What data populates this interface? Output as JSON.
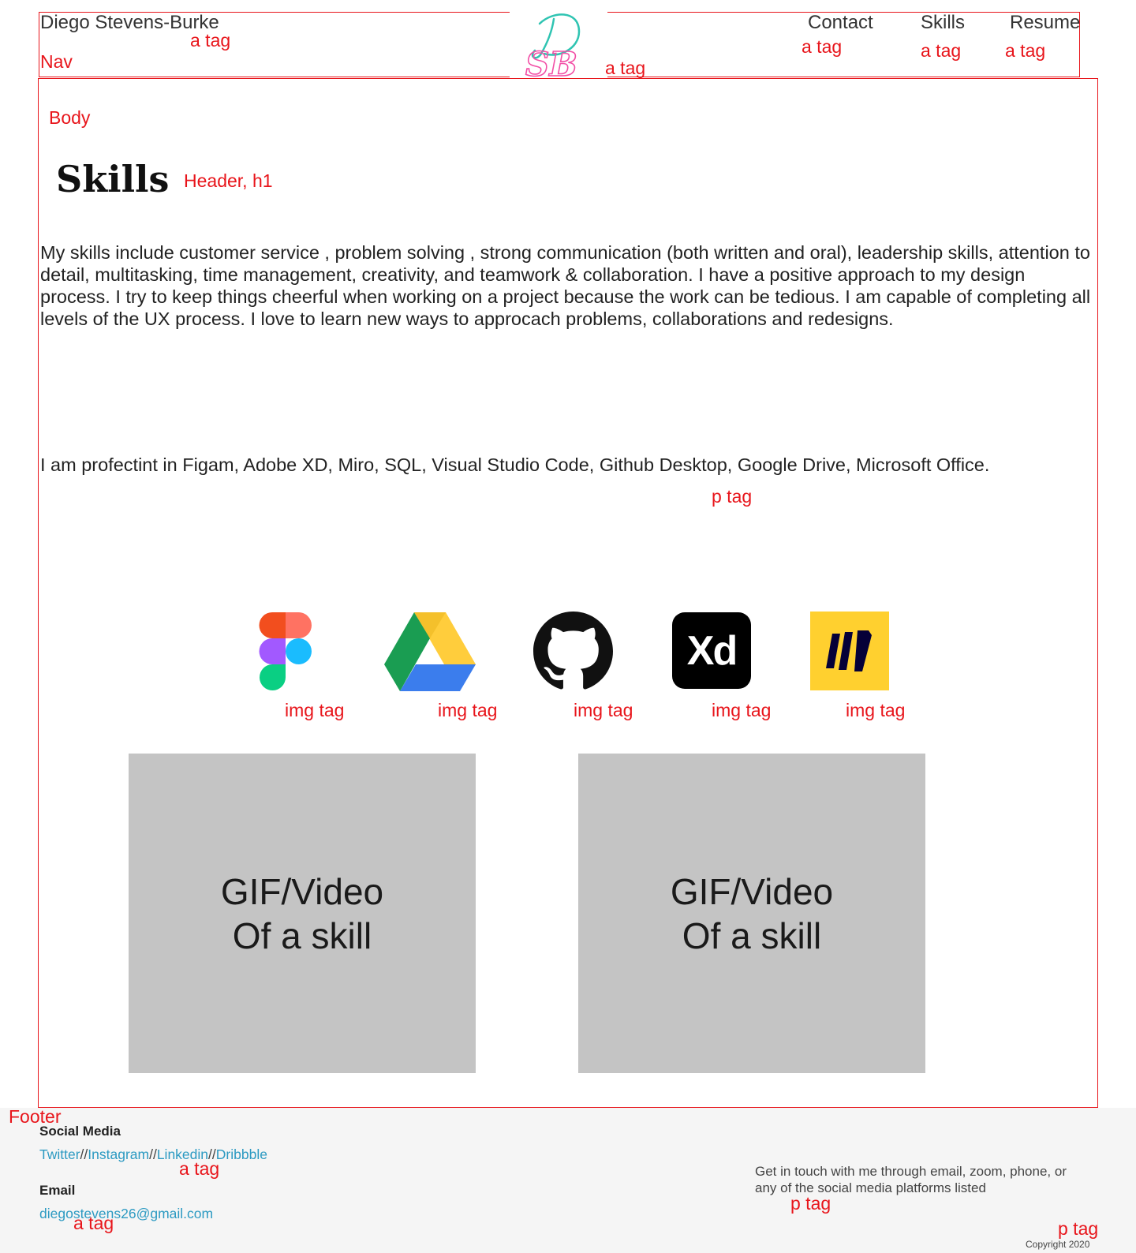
{
  "annotations": {
    "a_tag": "a tag",
    "nav": "Nav",
    "body": "Body",
    "header_h1": "Header, h1",
    "p_tag": "p tag",
    "img_tag": "img tag",
    "footer": "Footer"
  },
  "nav": {
    "brand": "Diego Stevens-Burke",
    "logo_text": "SB",
    "links": [
      "Contact",
      "Skills",
      "Resume"
    ]
  },
  "main": {
    "title": "Skills",
    "paragraph1": "My skills include customer service , problem solving , strong communication (both written and oral), leadership skills, attention to detail, multitasking,  time management, creativity, and teamwork & collaboration. I have a positive approach to my design process. I try to keep things cheerful when working on a project because the work can be tedious. I am capable of completing all levels of the UX process. I love to learn new ways to approcach problems, collaborations and redesigns.",
    "paragraph2": "I am profectint in Figam, Adobe XD, Miro, SQL, Visual Studio Code, Github Desktop, Google Drive, Microsoft Office.",
    "icons": [
      "figma-icon",
      "google-drive-icon",
      "github-icon",
      "adobe-xd-icon",
      "miro-icon"
    ],
    "xd_text": "Xd",
    "media": [
      "GIF/Video\nOf a skill",
      "GIF/Video\nOf a skill"
    ]
  },
  "footer": {
    "social_heading": "Social Media",
    "social_links": [
      "Twitter",
      "Instagram",
      "Linkedin",
      "Dribbble"
    ],
    "separator": "//",
    "email_heading": "Email",
    "email": "diegostevens26@gmail.com",
    "contact_text": "Get in touch with me through email, zoom, phone, or any of the social media platforms listed",
    "copyright": "Copyright 2020"
  },
  "colors": {
    "annotation": "#e8151b",
    "link": "#2c9ac2",
    "placeholder": "#c4c4c4",
    "footer_bg": "#f5f5f5",
    "logo_teal": "#2fc4b2",
    "logo_pink": "#f24fa6"
  }
}
